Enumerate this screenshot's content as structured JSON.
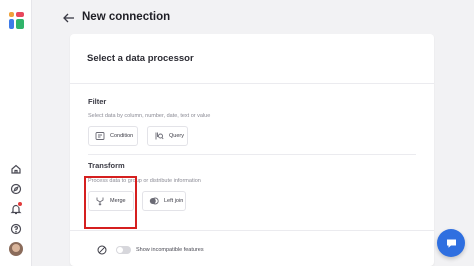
{
  "header": {
    "title": "New connection"
  },
  "card": {
    "title": "Select a data processor"
  },
  "filter": {
    "heading": "Filter",
    "description": "Select data by column, number, date, text or value",
    "options": [
      {
        "label": "Condition",
        "icon": "condition-icon"
      },
      {
        "label": "Query",
        "icon": "query-icon"
      }
    ]
  },
  "transform": {
    "heading": "Transform",
    "description": "Process data to group or distribute information",
    "options": [
      {
        "label": "Merge",
        "icon": "merge-icon",
        "highlighted": true
      },
      {
        "label": "Left join",
        "icon": "left-join-icon"
      }
    ]
  },
  "footer": {
    "toggle_label": "Show incompatible features",
    "toggle_on": false
  },
  "sidebar": {
    "icons": [
      "home-icon",
      "compass-icon",
      "bell-icon",
      "help-icon",
      "avatar"
    ],
    "notification_dot_color": "#e23b3b"
  },
  "colors": {
    "accent": "#2f6fe0",
    "highlight": "#d51f1f"
  }
}
